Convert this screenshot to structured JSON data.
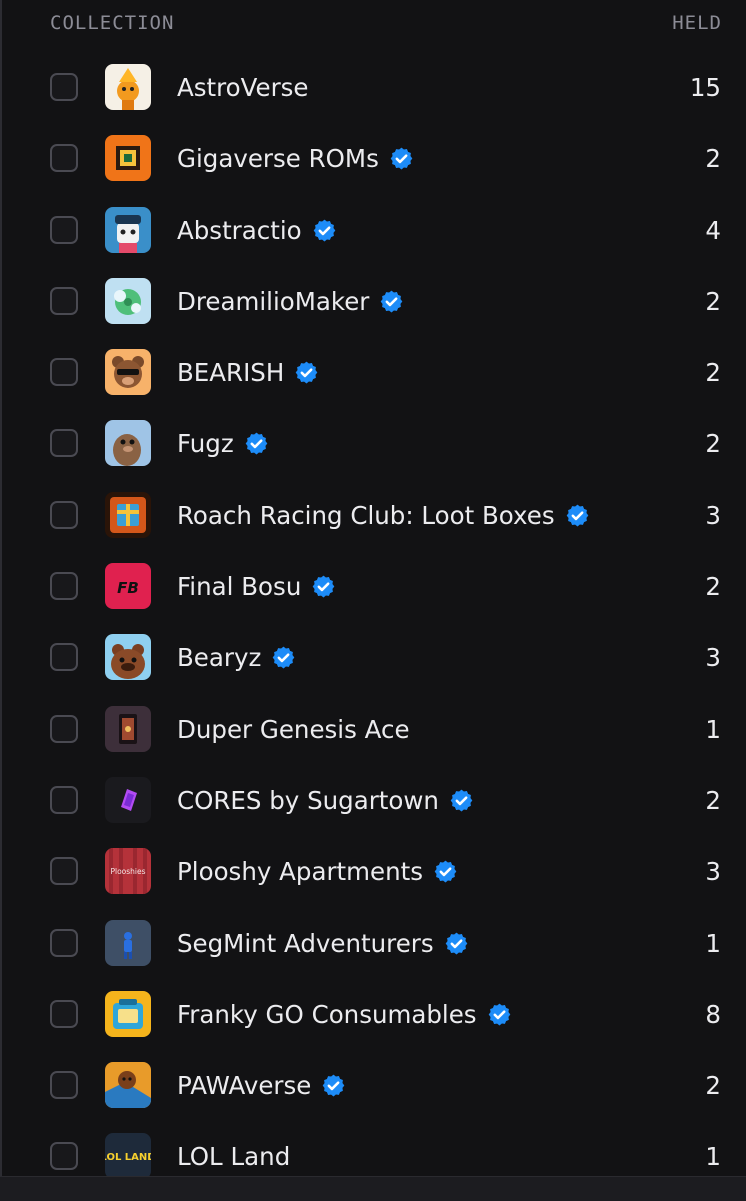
{
  "header": {
    "collection_label": "COLLECTION",
    "held_label": "HELD"
  },
  "colors": {
    "background": "#121214",
    "verified": "#1d8cf8",
    "muted": "#8c8c96"
  },
  "rows": [
    {
      "name": "AstroVerse",
      "held": "15",
      "verified": false,
      "thumb_icon": "astroverse-thumb-icon"
    },
    {
      "name": "Gigaverse ROMs",
      "held": "2",
      "verified": true,
      "thumb_icon": "gigaverse-roms-thumb-icon"
    },
    {
      "name": "Abstractio",
      "held": "4",
      "verified": true,
      "thumb_icon": "abstractio-thumb-icon"
    },
    {
      "name": "DreamilioMaker",
      "held": "2",
      "verified": true,
      "thumb_icon": "dreamiliomaker-thumb-icon"
    },
    {
      "name": "BEARISH",
      "held": "2",
      "verified": true,
      "thumb_icon": "bearish-thumb-icon"
    },
    {
      "name": "Fugz",
      "held": "2",
      "verified": true,
      "thumb_icon": "fugz-thumb-icon"
    },
    {
      "name": "Roach Racing Club: Loot Boxes",
      "held": "3",
      "verified": true,
      "thumb_icon": "roach-racing-thumb-icon"
    },
    {
      "name": "Final Bosu",
      "held": "2",
      "verified": true,
      "thumb_icon": "final-bosu-thumb-icon",
      "thumb_text": "FB"
    },
    {
      "name": "Bearyz",
      "held": "3",
      "verified": true,
      "thumb_icon": "bearyz-thumb-icon"
    },
    {
      "name": "Duper Genesis Ace",
      "held": "1",
      "verified": false,
      "thumb_icon": "duper-genesis-thumb-icon"
    },
    {
      "name": "CORES by Sugartown",
      "held": "2",
      "verified": true,
      "thumb_icon": "cores-thumb-icon"
    },
    {
      "name": "Plooshy Apartments",
      "held": "3",
      "verified": true,
      "thumb_icon": "plooshy-thumb-icon",
      "thumb_text": "Plooshies"
    },
    {
      "name": "SegMint Adventurers",
      "held": "1",
      "verified": true,
      "thumb_icon": "segmint-thumb-icon"
    },
    {
      "name": "Franky GO Consumables",
      "held": "8",
      "verified": true,
      "thumb_icon": "franky-go-thumb-icon"
    },
    {
      "name": "PAWAverse",
      "held": "2",
      "verified": true,
      "thumb_icon": "pawaverse-thumb-icon"
    },
    {
      "name": "LOL Land",
      "held": "1",
      "verified": false,
      "thumb_icon": "lol-land-thumb-icon",
      "thumb_text": "LOL LAND"
    }
  ]
}
